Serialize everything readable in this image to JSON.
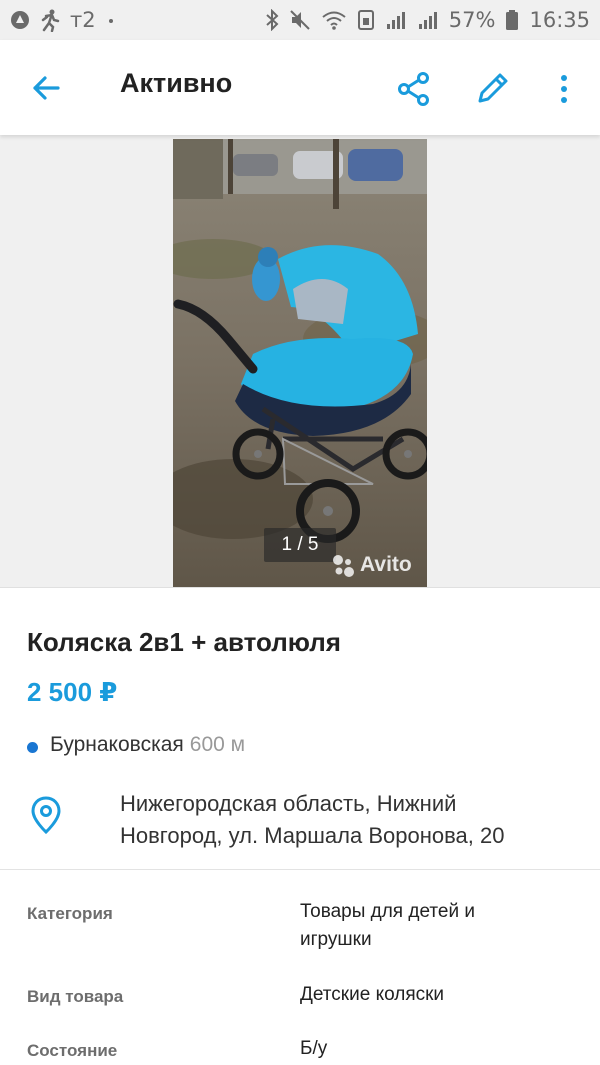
{
  "statusbar": {
    "carrier": "т2",
    "battery_percent": "57%",
    "time": "16:35",
    "icons": [
      "assistant-icon",
      "running-icon",
      "dot-icon",
      "bluetooth-icon",
      "mute-icon",
      "wifi-icon",
      "sim-icon",
      "signal-icon",
      "signal-icon",
      "battery-icon"
    ]
  },
  "appbar": {
    "title": "Активно"
  },
  "gallery": {
    "counter": "1 / 5",
    "watermark": "Avito"
  },
  "listing": {
    "title": "Коляска 2в1 + автолюля",
    "price": "2 500 ₽",
    "metro_station": "Бурнаковская",
    "metro_distance": "600 м",
    "address_line1": "Нижегородская область, Нижний",
    "address_line2": "Новгород, ул. Маршала Воронова, 20"
  },
  "params": [
    {
      "label": "Категория",
      "value": "Товары для детей и игрушки"
    },
    {
      "label": "Вид товара",
      "value": "Детские коляски"
    },
    {
      "label": "Состояние",
      "value": "Б/у"
    }
  ],
  "colors": {
    "accent": "#1a9bdc",
    "metro_dot": "#1976d2",
    "statusbar_bg": "#f0f0f0"
  }
}
